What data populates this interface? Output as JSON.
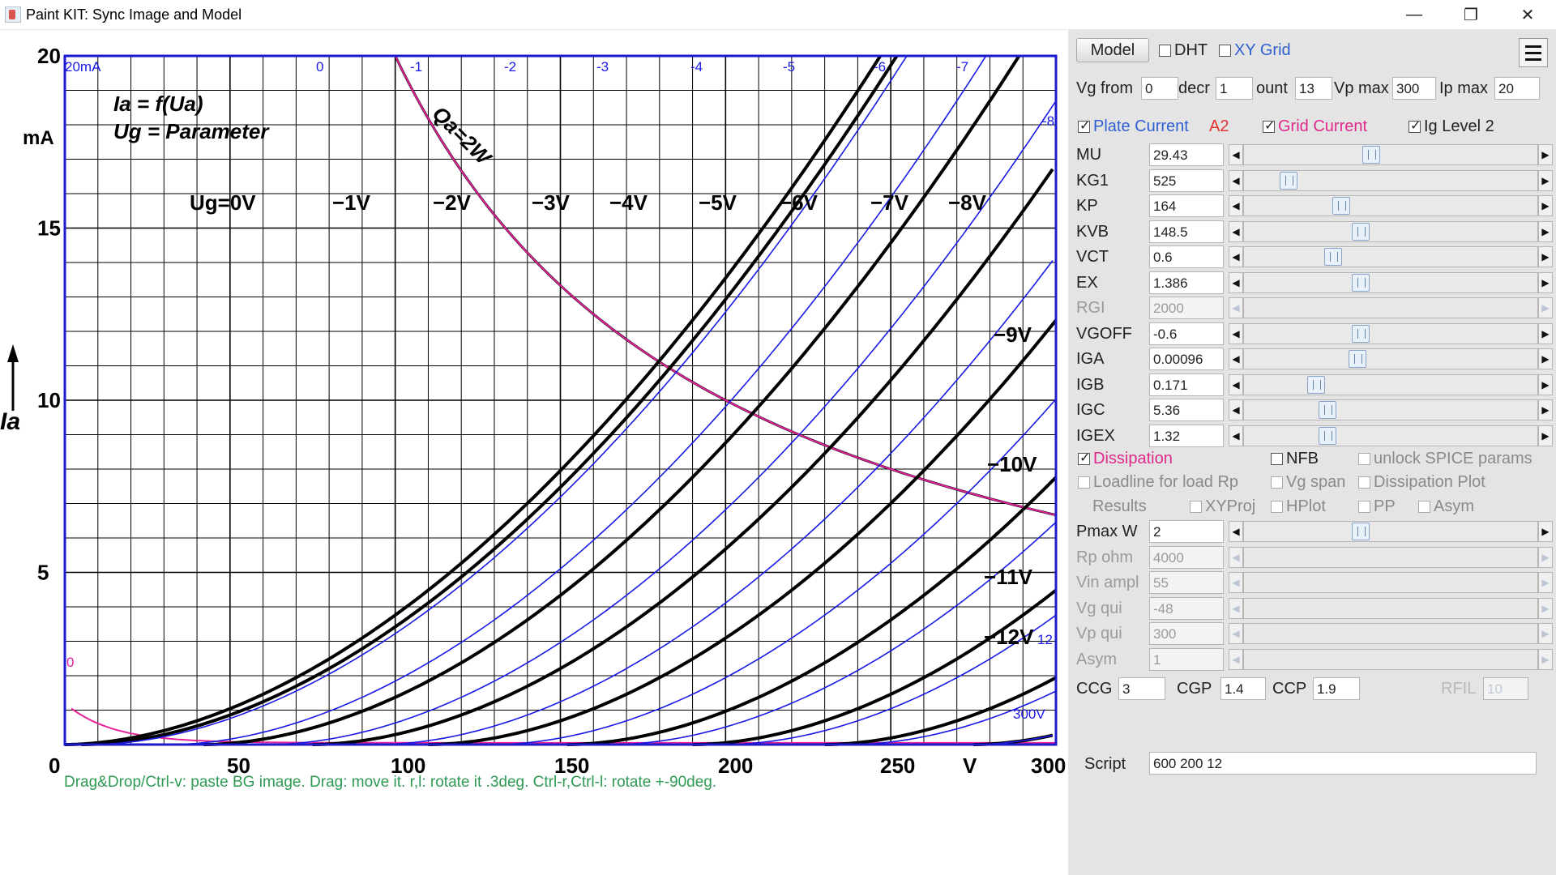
{
  "window": {
    "title": "Paint KIT: Sync Image and Model",
    "minimize": "—",
    "maximize": "❐",
    "close": "✕"
  },
  "chart_data": {
    "type": "line",
    "xlim": [
      0,
      300
    ],
    "ylim": [
      0,
      20
    ],
    "x_ticks": [
      "0",
      "50",
      "100",
      "150",
      "200",
      "250",
      "V",
      "300"
    ],
    "y_ticks": [
      "20",
      "15",
      "10",
      "5"
    ],
    "y_unit": "mA",
    "y_axis_label": "Ia",
    "formula_line1": "Ia = f(Ua)",
    "formula_line2": "Ug = Parameter",
    "dissipation_label": "Qa=2W",
    "curve_labels": [
      "Ug=0V",
      "−1V",
      "−2V",
      "−3V",
      "−4V",
      "−5V",
      "−6V",
      "−7V",
      "−8V",
      "−9V",
      "−10V",
      "−11V",
      "−12V"
    ],
    "model_labels": [
      "20mA",
      "0",
      "-1",
      "-2",
      "-3",
      "-4",
      "-5",
      "-6",
      "-7",
      "-8",
      "12",
      "300V",
      "0"
    ],
    "grid": true,
    "colors": {
      "frame": "#1a1ad0",
      "model": "#1a1ae6",
      "datasheet": "#000000",
      "dissipation": "#e6229a"
    }
  },
  "hint": "Drag&Drop/Ctrl-v: paste BG image. Drag: move it. r,l: rotate it .3deg. Ctrl-r,Ctrl-l: rotate +-90deg.",
  "panel": {
    "model_button": "Model",
    "dht": {
      "label": "DHT",
      "checked": false
    },
    "xy_grid": {
      "label": "XY Grid",
      "checked": false
    },
    "vg_from": {
      "label": "Vg from",
      "value": "0"
    },
    "decr": {
      "label": "decr",
      "value": "1"
    },
    "count": {
      "label": "ount",
      "value": "13"
    },
    "vp_max": {
      "label": "Vp max",
      "value": "300"
    },
    "ip_max": {
      "label": "Ip max",
      "value": "20"
    },
    "plate_current": {
      "label": "Plate Current",
      "checked": true
    },
    "a2_label": "A2",
    "grid_current": {
      "label": "Grid Current",
      "checked": true
    },
    "ig_level2": {
      "label": "Ig Level 2",
      "checked": true
    },
    "params": [
      {
        "name": "MU",
        "value": "29.43",
        "pos": 0.43,
        "enabled": true
      },
      {
        "name": "KG1",
        "value": "525",
        "pos": 0.13,
        "enabled": true
      },
      {
        "name": "KP",
        "value": "164",
        "pos": 0.32,
        "enabled": true
      },
      {
        "name": "KVB",
        "value": "148.5",
        "pos": 0.39,
        "enabled": true
      },
      {
        "name": "VCT",
        "value": "0.6",
        "pos": 0.29,
        "enabled": true
      },
      {
        "name": "EX",
        "value": "1.386",
        "pos": 0.39,
        "enabled": true
      },
      {
        "name": "RGI",
        "value": "2000",
        "pos": null,
        "enabled": false
      },
      {
        "name": "VGOFF",
        "value": "-0.6",
        "pos": 0.39,
        "enabled": true
      },
      {
        "name": "IGA",
        "value": "0.00096",
        "pos": 0.38,
        "enabled": true
      },
      {
        "name": "IGB",
        "value": "0.171",
        "pos": 0.23,
        "enabled": true
      },
      {
        "name": "IGC",
        "value": "5.36",
        "pos": 0.27,
        "enabled": true
      },
      {
        "name": "IGEX",
        "value": "1.32",
        "pos": 0.27,
        "enabled": true
      }
    ],
    "dissipation": {
      "label": "Dissipation",
      "checked": true
    },
    "nfb": {
      "label": "NFB",
      "checked": false
    },
    "unlock_spice": {
      "label": "unlock SPICE params",
      "checked": false
    },
    "loadline": {
      "label": "Loadline for load Rp",
      "checked": false
    },
    "vg_span": {
      "label": "Vg span",
      "checked": false
    },
    "dissipation_plot": {
      "label": "Dissipation Plot",
      "checked": false
    },
    "results_label": "Results",
    "xyproj": {
      "label": "XYProj",
      "checked": false
    },
    "hplot": {
      "label": "HPlot",
      "checked": false
    },
    "pp": {
      "label": "PP",
      "checked": false
    },
    "asym_cb": {
      "label": "Asym",
      "checked": false
    },
    "extra_params": [
      {
        "name": "Pmax W",
        "value": "2",
        "pos": 0.39,
        "enabled": true
      },
      {
        "name": "Rp ohm",
        "value": "4000",
        "pos": null,
        "enabled": false
      },
      {
        "name": "Vin ampl",
        "value": "55",
        "pos": null,
        "enabled": false
      },
      {
        "name": "Vg qui",
        "value": "-48",
        "pos": null,
        "enabled": false
      },
      {
        "name": "Vp qui",
        "value": "300",
        "pos": null,
        "enabled": false
      },
      {
        "name": "Asym",
        "value": "1",
        "pos": null,
        "enabled": false
      }
    ],
    "ccg": {
      "label": "CCG",
      "value": "3"
    },
    "cgp": {
      "label": "CGP",
      "value": "1.4"
    },
    "ccp": {
      "label": "CCP",
      "value": "1.9"
    },
    "rfil": {
      "label": "RFIL",
      "value": "10"
    },
    "script": {
      "label": "Script",
      "value": "600 200 12"
    }
  }
}
